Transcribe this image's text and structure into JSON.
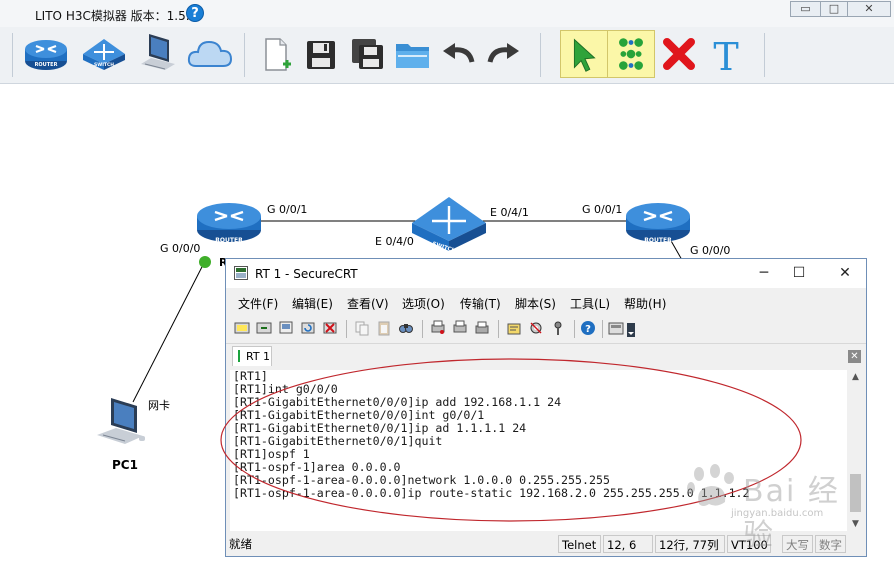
{
  "app": {
    "title": "LITO H3C模拟器 版本：1.5.2",
    "help_glyph": "?",
    "window_buttons": [
      "▭",
      "□",
      "✕"
    ]
  },
  "toolbar": {
    "items": [
      {
        "name": "router-tool",
        "icon": "router-icon",
        "label": "ROUTER"
      },
      {
        "name": "switch-tool",
        "icon": "switch-icon",
        "label": "SWITCH"
      },
      {
        "name": "pc-tool",
        "icon": "pc-icon"
      },
      {
        "name": "cloud-tool",
        "icon": "cloud-icon"
      },
      {
        "name": "new-file-tool",
        "icon": "new-file-icon"
      },
      {
        "name": "save-tool",
        "icon": "save-icon"
      },
      {
        "name": "save-as-tool",
        "icon": "save-as-icon"
      },
      {
        "name": "open-folder-tool",
        "icon": "folder-open-icon"
      },
      {
        "name": "undo-tool",
        "icon": "undo-icon"
      },
      {
        "name": "redo-tool",
        "icon": "redo-icon"
      },
      {
        "name": "select-tool",
        "icon": "pointer-icon",
        "selected": true
      },
      {
        "name": "connect-tool",
        "icon": "connect-icon",
        "selected": true
      },
      {
        "name": "delete-tool",
        "icon": "delete-icon"
      },
      {
        "name": "text-tool",
        "icon": "text-icon",
        "label": "T"
      }
    ]
  },
  "topology": {
    "device_type_label_router": "ROUTER",
    "device_type_label_switch": "SWITCH",
    "rt1_name_partial": "R",
    "pc_name": "PC1",
    "ports": {
      "rt1_g000": "G 0/0/0",
      "rt1_g001": "G 0/0/1",
      "sw_e040": "E 0/4/0",
      "sw_e041": "E 0/4/1",
      "rt2_g001": "G 0/0/1",
      "rt2_g000": "G 0/0/0",
      "pc_nic": "网卡"
    },
    "status_color": "#3fae2a"
  },
  "crt": {
    "title": "RT 1 - SecureCRT",
    "window_buttons": [
      "─",
      "☐",
      "✕"
    ],
    "menu": [
      "文件(F)",
      "编辑(E)",
      "查看(V)",
      "选项(O)",
      "传输(T)",
      "脚本(S)",
      "工具(L)",
      "帮助(H)"
    ],
    "tab_label": "RT 1",
    "tab_close": "✕",
    "terminal_lines": [
      "[RT1]",
      "[RT1]int g0/0/0",
      "[RT1-GigabitEthernet0/0/0]ip add 192.168.1.1 24",
      "[RT1-GigabitEthernet0/0/0]int g0/0/1",
      "[RT1-GigabitEthernet0/0/1]ip ad 1.1.1.1 24",
      "[RT1-GigabitEthernet0/0/1]quit",
      "[RT1]ospf 1",
      "[RT1-ospf-1]area 0.0.0.0",
      "[RT1-ospf-1-area-0.0.0.0]network 1.0.0.0 0.255.255.255",
      "[RT1-ospf-1-area-0.0.0.0]ip route-static 192.168.2.0 255.255.255.0 1.1.1.2"
    ],
    "status": {
      "ready": "就绪",
      "protocol": "Telnet",
      "cursor": "12,  6",
      "size": "12行, 77列",
      "terminal": "VT100",
      "caps": "大写",
      "num": "数字"
    },
    "scroll_up": "▲",
    "scroll_down": "▼"
  },
  "watermark": {
    "text": "Bai 经验",
    "sub": "jingyan.baidu.com"
  },
  "colors": {
    "annotation_ellipse": "#c0272d",
    "router_blue": "#1f6fc1",
    "selected_tool_bg": "#fbf7a8"
  }
}
